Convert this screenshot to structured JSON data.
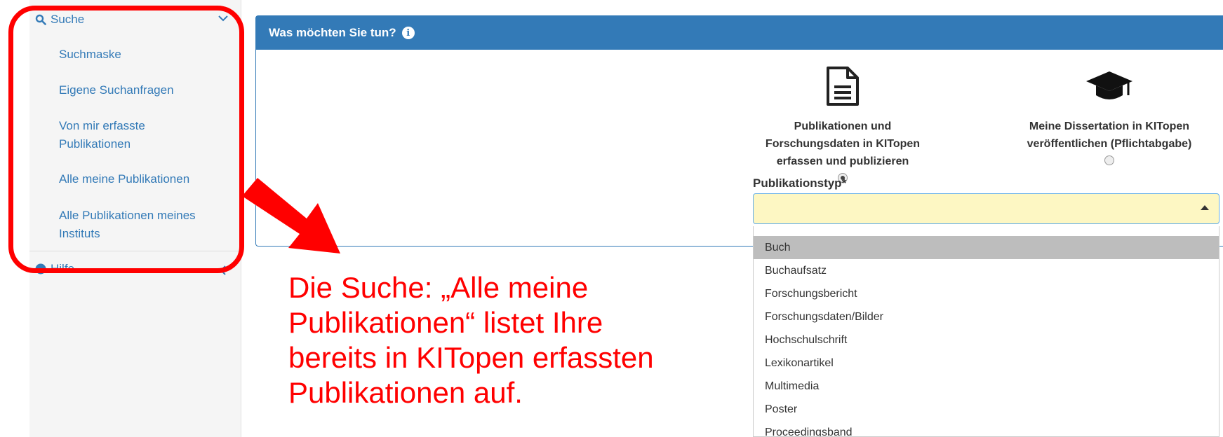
{
  "sidebar": {
    "suche_label": "Suche",
    "hilfe_label": "Hilfe",
    "items": [
      {
        "label": "Suchmaske"
      },
      {
        "label": "Eigene Suchanfragen"
      },
      {
        "label": "Von mir erfasste Publikationen"
      },
      {
        "label": "Alle meine Publikationen"
      },
      {
        "label": "Alle Publikationen meines Instituts"
      }
    ]
  },
  "panel": {
    "title": "Was möchten Sie tun?",
    "choices": [
      {
        "label": "Publikationen und Forschungsdaten in KITopen erfassen und publizieren",
        "icon": "document-icon",
        "selected": true
      },
      {
        "label": "Meine Dissertation in KITopen veröffentlichen (Pflichtabgabe)",
        "icon": "graduation-cap-icon",
        "selected": false
      }
    ],
    "publikationstyp_label": "Publikationstyp*",
    "publikationstyp_value": ""
  },
  "dropdown": {
    "options": [
      "Buch",
      "Buchaufsatz",
      "Forschungsbericht",
      "Forschungsdaten/Bilder",
      "Hochschulschrift",
      "Lexikonartikel",
      "Multimedia",
      "Poster",
      "Proceedingsband"
    ],
    "highlighted": "Buch"
  },
  "annotation": {
    "text": "Die Suche: „Alle meine Publikationen“ listet Ihre bereits in KITopen erfassten Publikationen auf.",
    "color": "#ff0000"
  },
  "colors": {
    "accent": "#337ab7",
    "select_bg": "#fdf7c3"
  }
}
